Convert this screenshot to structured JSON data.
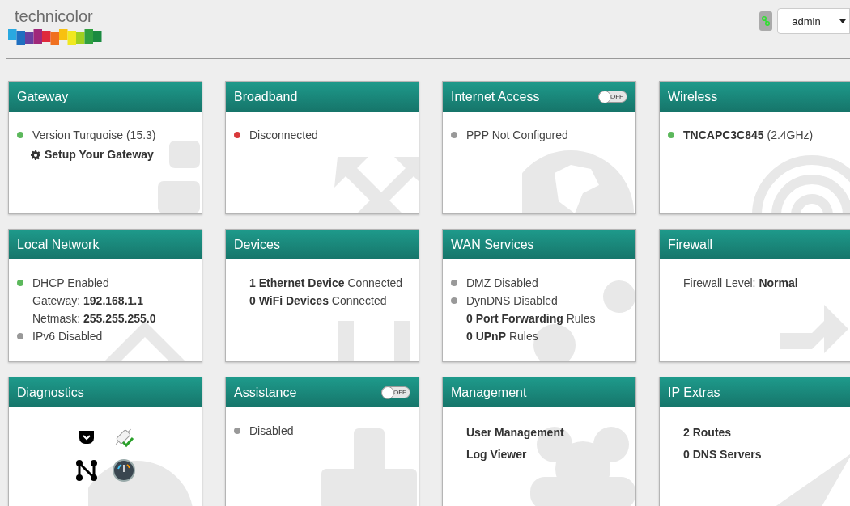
{
  "header": {
    "logo_text": "technicolor",
    "user_menu": {
      "label": "admin"
    }
  },
  "cards": [
    {
      "title": "Gateway",
      "lines": [
        {
          "kind": "status",
          "color": "#5cb85c",
          "text": "Version Turquoise (15.3)"
        },
        {
          "kind": "action",
          "text": "Setup Your Gateway"
        }
      ]
    },
    {
      "title": "Broadband",
      "lines": [
        {
          "kind": "status",
          "color": "#d9383a",
          "text": "Disconnected"
        }
      ]
    },
    {
      "title": "Internet Access",
      "toggle": {
        "label": "OFF",
        "on": false
      },
      "lines": [
        {
          "kind": "status",
          "color": "#999999",
          "text": "PPP Not Configured"
        }
      ]
    },
    {
      "title": "Wireless",
      "lines": [
        {
          "kind": "status",
          "color": "#5cb85c",
          "text": "**TNCAPC3C845** (2.4GHz)"
        }
      ]
    },
    {
      "title": "Local Network",
      "lines": [
        {
          "kind": "status",
          "color": "#5cb85c",
          "text": "DHCP Enabled"
        },
        {
          "kind": "plain",
          "text": "Gateway: **192.168.1.1**"
        },
        {
          "kind": "plain",
          "text": "Netmask: **255.255.255.0**"
        },
        {
          "kind": "status",
          "color": "#999999",
          "text": "IPv6 Disabled"
        }
      ]
    },
    {
      "title": "Devices",
      "lines": [
        {
          "kind": "plain",
          "text": "**1 Ethernet Device** Connected"
        },
        {
          "kind": "plain",
          "text": "**0 WiFi Devices** Connected"
        }
      ]
    },
    {
      "title": "WAN Services",
      "lines": [
        {
          "kind": "status",
          "color": "#999999",
          "text": "DMZ Disabled"
        },
        {
          "kind": "status",
          "color": "#999999",
          "text": "DynDNS Disabled"
        },
        {
          "kind": "plain",
          "text": "**0 Port Forwarding** Rules"
        },
        {
          "kind": "plain",
          "text": "**0 UPnP** Rules"
        }
      ]
    },
    {
      "title": "Firewall",
      "lines": [
        {
          "kind": "plain",
          "text": "Firewall Level: **Normal**"
        }
      ]
    },
    {
      "title": "Diagnostics",
      "lines": [
        {
          "kind": "tools"
        }
      ]
    },
    {
      "title": "Assistance",
      "toggle": {
        "label": "OFF",
        "on": false
      },
      "lines": [
        {
          "kind": "status",
          "color": "#999999",
          "text": "Disabled"
        }
      ]
    },
    {
      "title": "Management",
      "lines": [
        {
          "kind": "link",
          "text": "User Management"
        },
        {
          "kind": "link",
          "text": "Log Viewer"
        }
      ]
    },
    {
      "title": "IP Extras",
      "lines": [
        {
          "kind": "link",
          "text": "2 Routes"
        },
        {
          "kind": "link",
          "text": "0 DNS Servers"
        }
      ]
    }
  ]
}
